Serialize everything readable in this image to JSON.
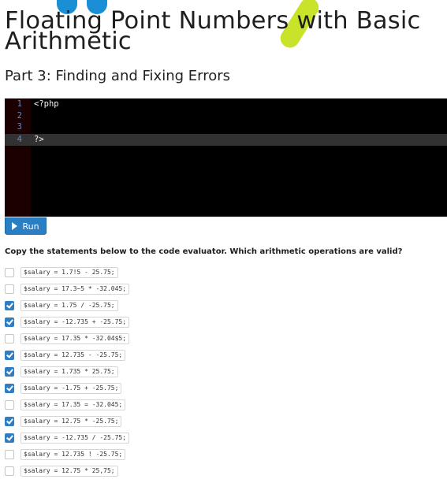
{
  "page": {
    "title": "Floating Point Numbers with Basic Arithmetic",
    "section_title": "Part 3: Finding and Fixing Errors"
  },
  "editor": {
    "lines": [
      {
        "number": "1",
        "text": "<?php",
        "active": false
      },
      {
        "number": "2",
        "text": "",
        "active": false
      },
      {
        "number": "3",
        "text": "",
        "active": false
      },
      {
        "number": "4",
        "text": "?>",
        "active": true
      }
    ]
  },
  "run_button": {
    "label": "Run",
    "icon": "play-icon"
  },
  "question": "Copy the statements below to the code evaluator. Which arithmetic operations are valid?",
  "options": [
    {
      "code": "$salary = 1.7!5 - 25.75;",
      "checked": false
    },
    {
      "code": "$salary = 17.3~5 * -32.045;",
      "checked": false
    },
    {
      "code": "$salary = 1.75 / -25.75;",
      "checked": true
    },
    {
      "code": "$salary = -12.735 + -25.75;",
      "checked": true
    },
    {
      "code": "$salary = 17.35 * -32.04$5;",
      "checked": false
    },
    {
      "code": "$salary = 12.735 - -25.75;",
      "checked": true
    },
    {
      "code": "$salary = 1.735 * 25.75;",
      "checked": true
    },
    {
      "code": "$salary = -1.75 + -25.75;",
      "checked": true
    },
    {
      "code": "$salary = 17.35 = -32.045;",
      "checked": false
    },
    {
      "code": "$salary = 12.75 * -25.75;",
      "checked": true
    },
    {
      "code": "$salary = -12.735 / -25.75;",
      "checked": true
    },
    {
      "code": "$salary = 12.735 ! -25.75;",
      "checked": false
    },
    {
      "code": "$salary = 12.75 * 25,75;",
      "checked": false
    }
  ],
  "colors": {
    "accent": "#2f7ec3",
    "editor_bg": "#000000",
    "gutter_bg": "#1a0000",
    "active_line": "#323232"
  }
}
